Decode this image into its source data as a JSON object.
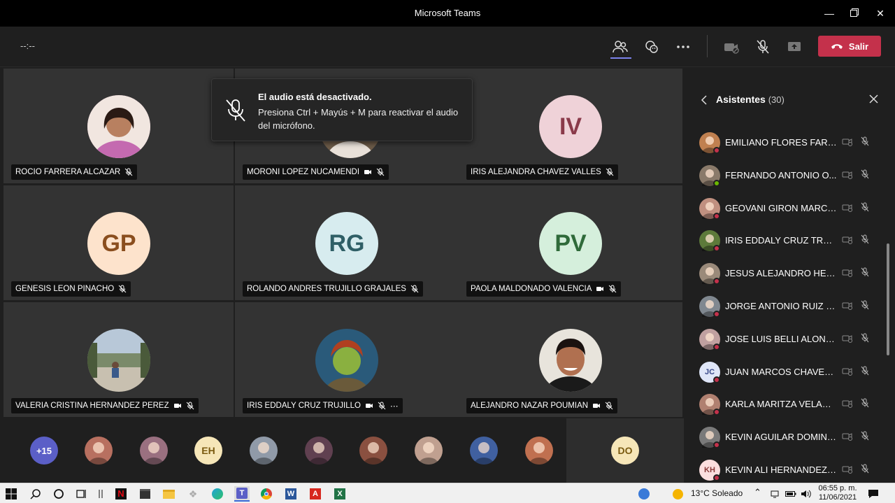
{
  "window": {
    "title": "Microsoft Teams"
  },
  "toolbar": {
    "timer": "--:--",
    "leave_label": "Salir"
  },
  "toast": {
    "title": "El audio está desactivado.",
    "message": "Presiona Ctrl + Mayús + M para reactivar el audio del micrófono."
  },
  "tiles": [
    {
      "name": "ROCIO FARRERA ALCAZAR",
      "initials": "",
      "photo_color": "#b97aa0"
    },
    {
      "name": "MORONI LOPEZ NUCAMENDI",
      "initials": "",
      "photo_color": "#5a4a3a"
    },
    {
      "name": "IRIS ALEJANDRA CHAVEZ VALLES",
      "initials": "IV",
      "bg": "#efd2d8",
      "fg": "#8a3a4a"
    },
    {
      "name": "GENESIS LEON PINACHO",
      "initials": "GP",
      "bg": "#fde3cc",
      "fg": "#8a4e1e"
    },
    {
      "name": "ROLANDO ANDRES TRUJILLO GRAJALES",
      "initials": "RG",
      "bg": "#d7ecef",
      "fg": "#2f5f66"
    },
    {
      "name": "PAOLA MALDONADO VALENCIA",
      "initials": "PV",
      "bg": "#d5efdc",
      "fg": "#2f6a3a"
    },
    {
      "name": "VALERIA CRISTINA HERNANDEZ PEREZ",
      "initials": "",
      "photo_color": "#8aa0a8"
    },
    {
      "name": "IRIS EDDALY CRUZ TRUJILLO",
      "initials": "",
      "photo_color": "#5d7a3a"
    },
    {
      "name": "ALEJANDRO NAZAR POUMIAN",
      "initials": "",
      "photo_color": "#c9a080"
    }
  ],
  "strip": {
    "overflow": "+15",
    "avatars": [
      {
        "initials": "",
        "color": "#b87060"
      },
      {
        "initials": "",
        "color": "#9a7080"
      },
      {
        "initials": "EH",
        "bg": "#f6e6b8",
        "fg": "#7a5a10"
      },
      {
        "initials": "",
        "color": "#909aa8"
      },
      {
        "initials": "",
        "color": "#604050"
      },
      {
        "initials": "",
        "color": "#8a5040"
      },
      {
        "initials": "",
        "color": "#c0a090"
      },
      {
        "initials": "",
        "color": "#4060a0"
      },
      {
        "initials": "",
        "color": "#c07050"
      }
    ],
    "self": {
      "initials": "DO",
      "bg": "#f6e6b8",
      "fg": "#7a5a10"
    }
  },
  "panel": {
    "title": "Asistentes",
    "count": "(30)",
    "attendees": [
      {
        "name": "EMILIANO FLORES FARRE...",
        "initials": "",
        "color": "#c08050",
        "status": "#c4314b"
      },
      {
        "name": "FERNANDO ANTONIO O...",
        "initials": "",
        "color": "#8a7a6a",
        "status": "#6bb700"
      },
      {
        "name": "GEOVANI GIRON MARCOS",
        "initials": "",
        "color": "#c09080",
        "status": "#c4314b"
      },
      {
        "name": "IRIS EDDALY CRUZ TRUJI...",
        "initials": "",
        "color": "#5d7a3a",
        "status": "#c4314b"
      },
      {
        "name": "JESUS ALEJANDRO HERN...",
        "initials": "",
        "color": "#9a8a7a",
        "status": "#c4314b"
      },
      {
        "name": "JORGE ANTONIO RUIZ C...",
        "initials": "",
        "color": "#808890",
        "status": "#c4314b"
      },
      {
        "name": "JOSE LUIS BELLI ALONSO",
        "initials": "",
        "color": "#c0a0a0",
        "status": "#c4314b"
      },
      {
        "name": "JUAN MARCOS CHAVEZ ...",
        "initials": "JC",
        "bg": "#dfe6f8",
        "fg": "#3a4a8a",
        "status": "#c4314b"
      },
      {
        "name": "KARLA MARITZA VELASC...",
        "initials": "",
        "color": "#b08070",
        "status": "#c4314b"
      },
      {
        "name": "KEVIN AGUILAR DOMING...",
        "initials": "",
        "color": "#7a7a7a",
        "status": "#c4314b"
      },
      {
        "name": "KEVIN ALI HERNANDEZ ...",
        "initials": "KH",
        "bg": "#fbdede",
        "fg": "#8a3a3a",
        "status": "#c4314b"
      }
    ]
  },
  "taskbar": {
    "weather": "13°C  Soleado",
    "time": "06:55 p. m.",
    "date": "11/06/2021"
  },
  "colors": {
    "accent": "#7b83eb",
    "leave": "#c4314b",
    "background": "#1f1f1f",
    "tile": "#333333"
  }
}
